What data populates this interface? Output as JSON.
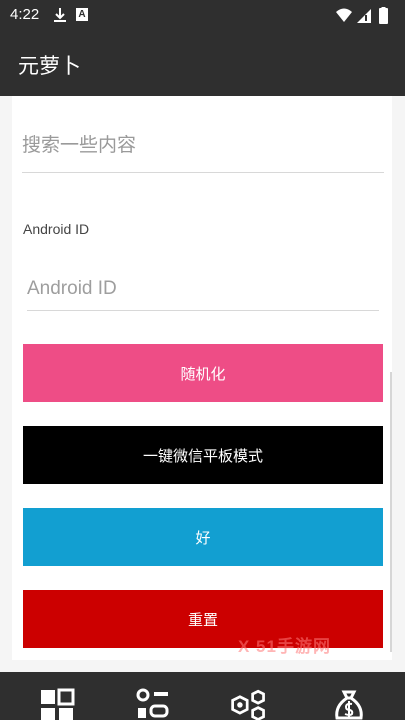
{
  "status_bar": {
    "time": "4:22",
    "indicator_letter": "A",
    "icons": [
      "download-icon",
      "wifi-icon",
      "signal-icon",
      "battery-icon"
    ]
  },
  "app_bar": {
    "title": "元萝卜"
  },
  "search": {
    "placeholder": "搜索一些内容",
    "value": ""
  },
  "android_id": {
    "label": "Android ID",
    "placeholder": "Android ID",
    "value": ""
  },
  "buttons": [
    {
      "label": "随机化",
      "color": "#ee4d86"
    },
    {
      "label": "一键微信平板模式",
      "color": "#000000"
    },
    {
      "label": "好",
      "color": "#129fd1"
    },
    {
      "label": "重置",
      "color": "#cc0000"
    }
  ],
  "watermark": "X 51手游网",
  "bottom_nav": [
    "grid-icon",
    "apps-icon",
    "hexagon-settings-icon",
    "money-bag-icon"
  ]
}
